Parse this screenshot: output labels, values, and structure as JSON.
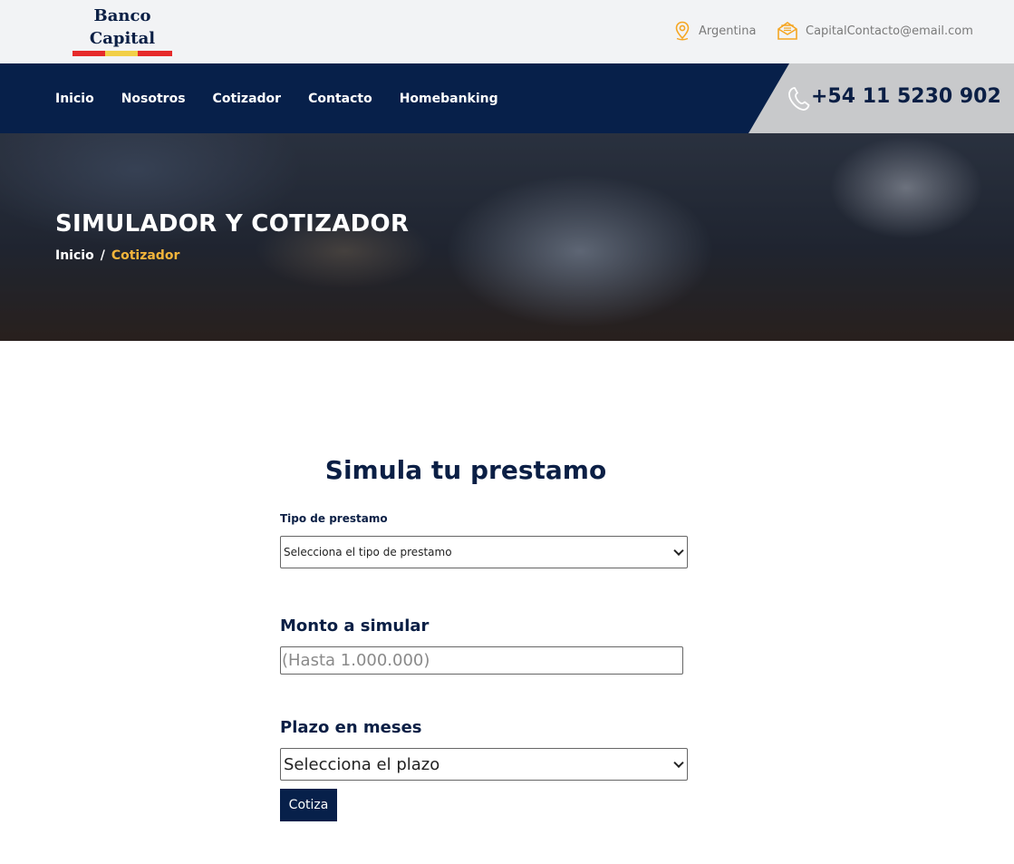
{
  "brand": {
    "line1": "Banco",
    "line2": "Capital"
  },
  "top_contact": {
    "country": "Argentina",
    "email": "CapitalContacto@email.com"
  },
  "nav": {
    "items": [
      {
        "label": "Inicio"
      },
      {
        "label": "Nosotros"
      },
      {
        "label": "Cotizador"
      },
      {
        "label": "Contacto"
      },
      {
        "label": "Homebanking"
      }
    ],
    "phone": "+54 11 5230 902"
  },
  "hero": {
    "title": "SIMULADOR Y COTIZADOR",
    "breadcrumb": {
      "home": "Inicio",
      "separator": "/",
      "current": "Cotizador"
    }
  },
  "form": {
    "title": "Simula tu prestamo",
    "tipo_label": "Tipo de prestamo",
    "tipo_selected": "Selecciona el tipo de prestamo",
    "monto_label": "Monto a simular",
    "monto_placeholder": "(Hasta 1.000.000)",
    "plazo_label": "Plazo en meses",
    "plazo_selected": "Selecciona el plazo",
    "submit_label": "Cotiza"
  },
  "colors": {
    "navy": "#07204a",
    "accent_gold": "#f3b53b",
    "icon_orange": "#f5a623",
    "logo_red": "#e62a2a",
    "logo_yellow": "#f2cf47"
  },
  "icons": {
    "country": "location-pin-icon",
    "email": "envelope-icon",
    "phone": "phone-icon",
    "select": "chevron-down-icon"
  }
}
